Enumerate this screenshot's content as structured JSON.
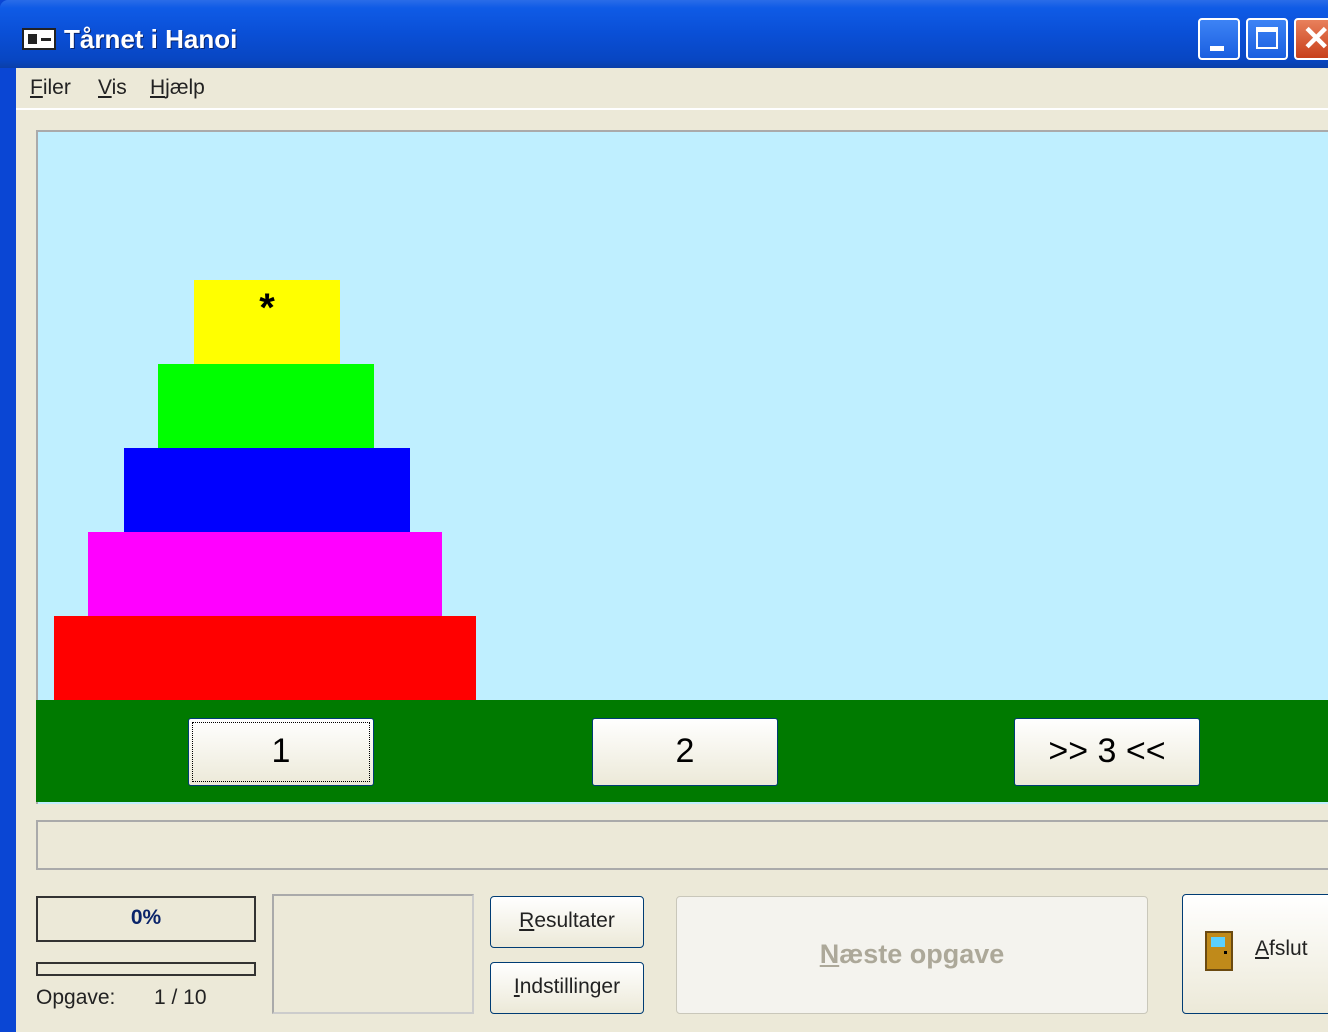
{
  "window": {
    "title": "Tårnet i Hanoi",
    "close_glyph": "✕"
  },
  "menu": [
    {
      "accel": "F",
      "rest": "iler"
    },
    {
      "accel": "V",
      "rest": "is"
    },
    {
      "accel": "H",
      "rest": "jælp"
    }
  ],
  "board": {
    "background": "#bfefff",
    "ground_color": "#007a00",
    "disks": [
      {
        "color": "#ffff00",
        "marker": "*"
      },
      {
        "color": "#00ff00",
        "marker": ""
      },
      {
        "color": "#0000ff",
        "marker": ""
      },
      {
        "color": "#ff00ff",
        "marker": ""
      },
      {
        "color": "#ff0000",
        "marker": ""
      }
    ],
    "pegs": [
      {
        "label": "1",
        "focused": true
      },
      {
        "label": "2",
        "focused": false
      },
      {
        "label": ">>  3  <<",
        "focused": false
      }
    ]
  },
  "progress": {
    "percent_label": "0%",
    "fraction": 0
  },
  "task": {
    "label": "Opgave:",
    "value": "1 / 10"
  },
  "buttons": {
    "results": {
      "accel": "R",
      "rest": "esultater"
    },
    "settings": {
      "accel": "I",
      "rest": "ndstillinger"
    },
    "next": {
      "accel": "N",
      "rest": "æste opgave"
    },
    "quit": {
      "accel": "A",
      "rest": "fslut"
    }
  },
  "icons": {
    "app": "app-window-icon",
    "quit": "door-icon"
  }
}
